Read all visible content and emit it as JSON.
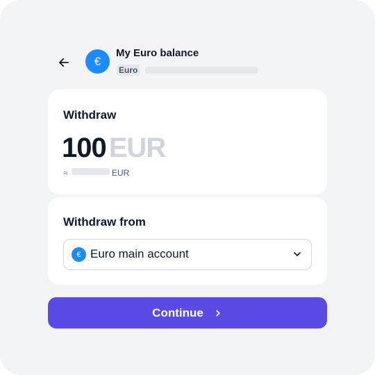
{
  "header": {
    "back_icon": "arrow-left-icon",
    "avatar_symbol": "€",
    "title": "My Euro balance",
    "currency": "Euro"
  },
  "amount_card": {
    "label": "Withdraw",
    "amount": "100",
    "currency": "EUR",
    "approx_symbol": "≈",
    "approx_currency": "EUR"
  },
  "from_card": {
    "label": "Withdraw from",
    "account_icon_symbol": "€",
    "selected_account": "Euro main account",
    "chevron_icon": "chevron-down-icon"
  },
  "continue_button": {
    "label": "Continue",
    "icon": "chevron-right-icon"
  },
  "colors": {
    "accent": "#5b4be6",
    "euro_blue": "#1a8cff",
    "background": "#f3f4f6"
  }
}
